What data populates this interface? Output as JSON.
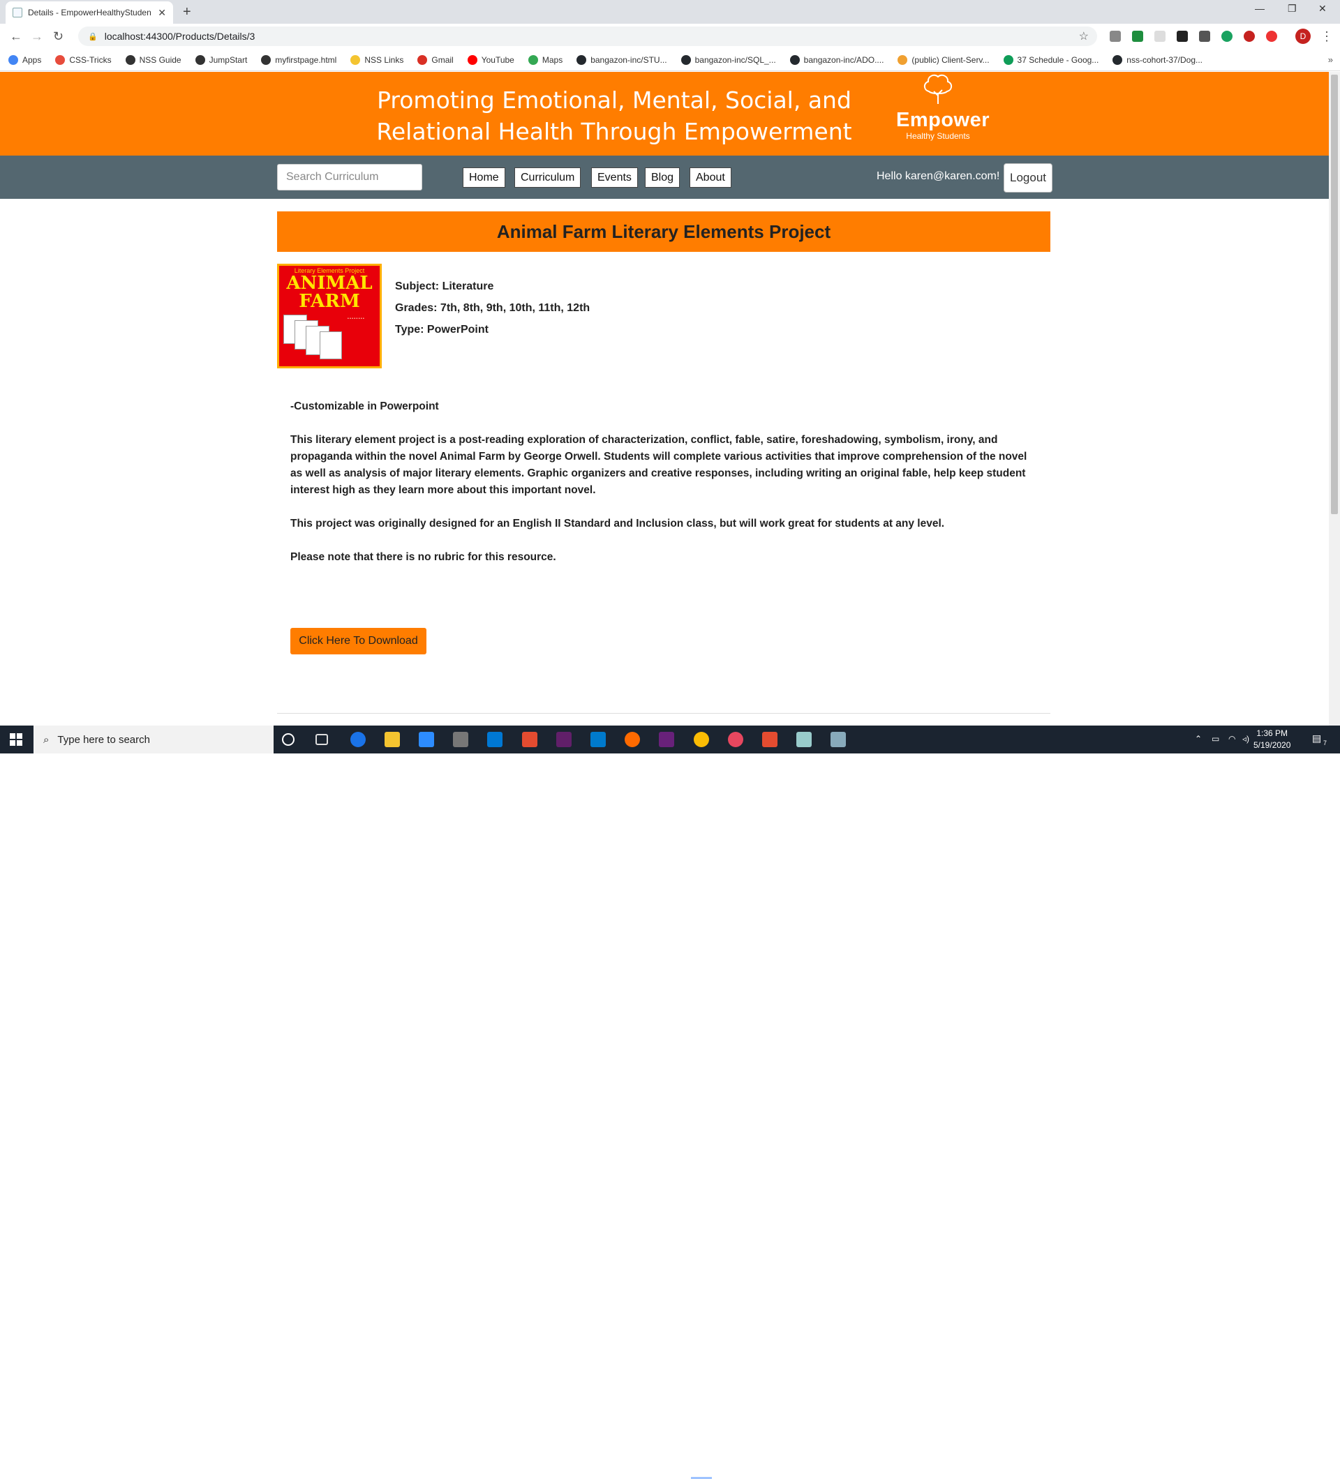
{
  "browser": {
    "tab_title": "Details - EmpowerHealthyStuden",
    "url": "localhost:44300/Products/Details/3",
    "profile_initial": "D",
    "bookmarks": [
      {
        "label": "Apps",
        "color": "#4285f4"
      },
      {
        "label": "CSS-Tricks",
        "color": "#e74c3c"
      },
      {
        "label": "NSS Guide",
        "color": "#333333"
      },
      {
        "label": "JumpStart",
        "color": "#333333"
      },
      {
        "label": "myfirstpage.html",
        "color": "#333333"
      },
      {
        "label": "NSS Links",
        "color": "#f4c430"
      },
      {
        "label": "Gmail",
        "color": "#d93025"
      },
      {
        "label": "YouTube",
        "color": "#ff0000"
      },
      {
        "label": "Maps",
        "color": "#34a853"
      },
      {
        "label": "bangazon-inc/STU...",
        "color": "#24292e"
      },
      {
        "label": "bangazon-inc/SQL_...",
        "color": "#24292e"
      },
      {
        "label": "bangazon-inc/ADO....",
        "color": "#24292e"
      },
      {
        "label": "(public) Client-Serv...",
        "color": "#f0a030"
      },
      {
        "label": "37 Schedule - Goog...",
        "color": "#0f9d58"
      },
      {
        "label": "nss-cohort-37/Dog...",
        "color": "#24292e"
      }
    ]
  },
  "site": {
    "tagline": "Promoting Emotional, Mental, Social, and Relational Health Through Empowerment",
    "logo_name": "Empower",
    "logo_sub": "Healthy Students",
    "search_placeholder": "Search Curriculum",
    "nav": [
      "Home",
      "Curriculum",
      "Events",
      "Blog",
      "About"
    ],
    "greeting": "Hello karen@karen.com!",
    "logout_label": "Logout",
    "brand_color": "#ff7d00",
    "nav_color": "#546770"
  },
  "product": {
    "title": "Animal Farm Literary Elements Project",
    "thumbnail": {
      "top_text": "Literary Elements Project",
      "main_line1": "ANIMAL",
      "main_line2": "FARM"
    },
    "subject": "Subject: Literature",
    "grades": "Grades: 7th, 8th, 9th, 10th, 11th, 12th",
    "type": "Type: PowerPoint",
    "description": [
      "-Customizable in Powerpoint",
      "This literary element project is a post-reading exploration of characterization, conflict, fable, satire, foreshadowing, symbolism, irony, and propaganda within the novel Animal Farm by George Orwell. Students will complete various activities that improve comprehension of the novel as well as analysis of major literary elements. Graphic organizers and creative responses, including writing an original fable, help keep student interest high as they learn more about this important novel.",
      "This project was originally designed for an English II Standard and Inclusion class, but will work great for students at any level.",
      "Please note that there is no rubric for this resource."
    ],
    "download_label": "Click Here To Download"
  },
  "taskbar": {
    "search_placeholder": "Type here to search",
    "time": "1:36 PM",
    "date": "5/19/2020",
    "notification_count": "7"
  }
}
